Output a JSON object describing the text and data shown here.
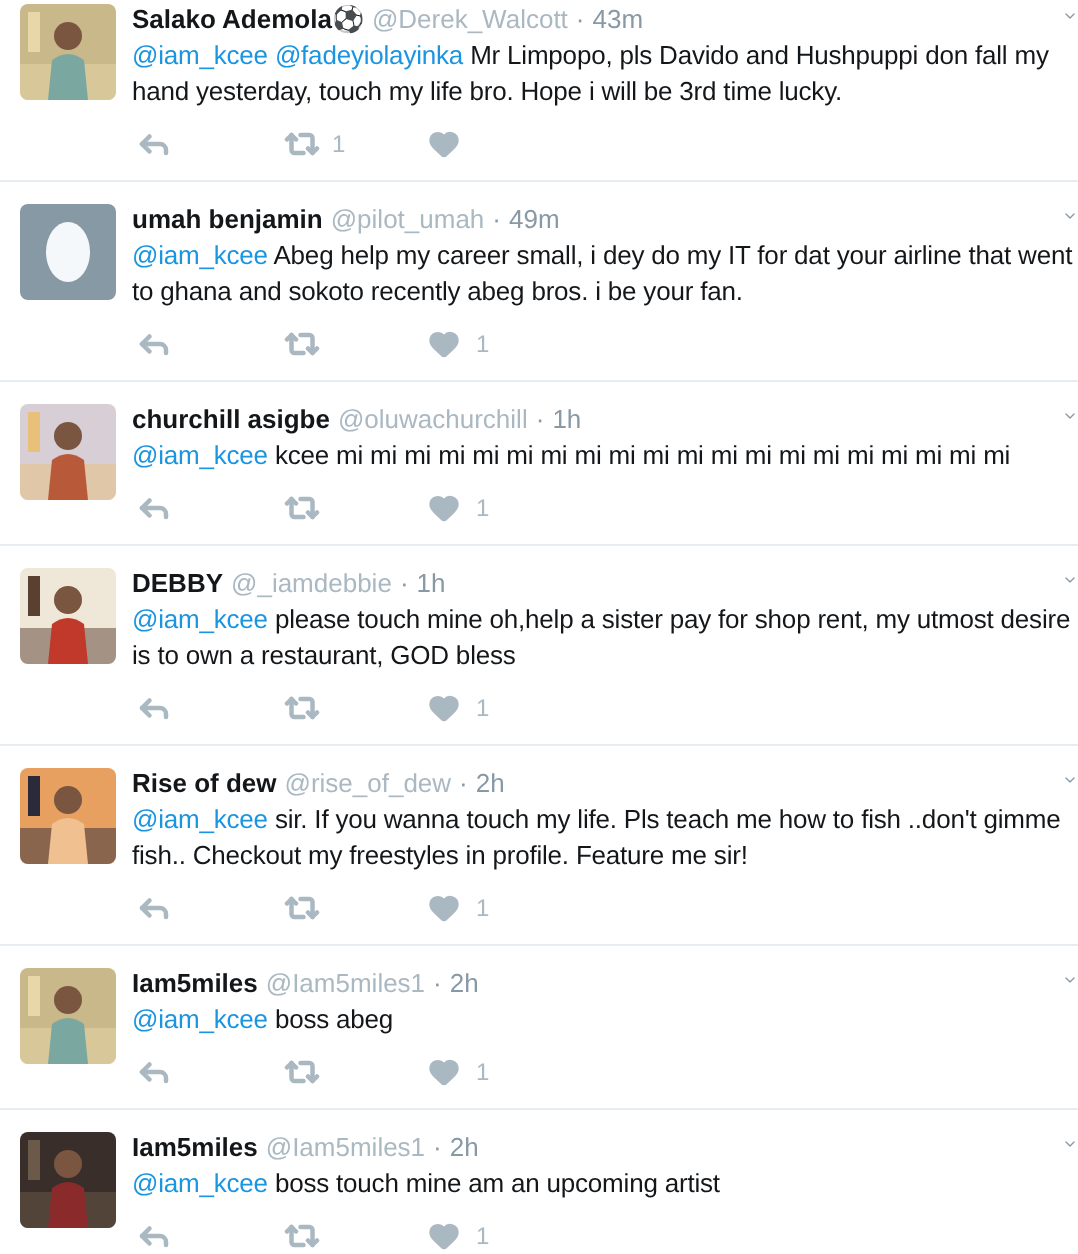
{
  "tweets": [
    {
      "name": "Salako Ademola⚽",
      "handle": "@Derek_Walcott",
      "separator": "·",
      "time": "43m",
      "avatar": {
        "kind": "picture"
      },
      "mentions": [
        "@iam_kcee",
        "@fadeyiolayinka"
      ],
      "text": "Mr Limpopo, pls Davido and Hushpuppi don fall my hand yesterday, touch my life bro. Hope i will be 3rd time lucky.",
      "retweets": "1"
    },
    {
      "name": "umah benjamin",
      "handle": "@pilot_umah",
      "separator": "·",
      "time": "49m",
      "avatar": {
        "kind": "egg"
      },
      "mentions": [
        "@iam_kcee"
      ],
      "text": "Abeg help my career small, i dey do my IT for dat your airline that went to ghana and sokoto recently abeg bros. i be your fan.",
      "likes": "1"
    },
    {
      "name": "churchill asigbe",
      "handle": "@oluwachurchill",
      "separator": "·",
      "time": "1h",
      "avatar": {
        "kind": "picture"
      },
      "mentions": [
        "@iam_kcee"
      ],
      "text": "kcee mi mi mi mi mi mi mi mi mi mi mi mi mi mi mi mi mi mi mi mi",
      "likes": "1"
    },
    {
      "name": "DEBBY",
      "handle": "@_iamdebbie",
      "separator": "·",
      "time": "1h",
      "avatar": {
        "kind": "picture"
      },
      "mentions": [
        "@iam_kcee"
      ],
      "text": "please touch mine oh,help a sister pay for shop rent, my utmost desire is to own a restaurant, GOD bless",
      "likes": "1"
    },
    {
      "name": "Rise of dew",
      "handle": "@rise_of_dew",
      "separator": "·",
      "time": "2h",
      "avatar": {
        "kind": "picture"
      },
      "mentions": [
        "@iam_kcee"
      ],
      "text": "sir. If you wanna touch my life. Pls teach me how to fish ..don't gimme fish.. Checkout my freestyles in profile. Feature me sir!",
      "likes": "1"
    },
    {
      "name": "Iam5miles",
      "handle": "@Iam5miles1",
      "separator": "·",
      "time": "2h",
      "avatar": {
        "kind": "picture"
      },
      "mentions": [
        "@iam_kcee"
      ],
      "text": "boss abeg",
      "likes": "1"
    },
    {
      "name": "Iam5miles",
      "handle": "@Iam5miles1",
      "separator": "·",
      "time": "2h",
      "avatar": {
        "kind": "picture"
      },
      "mentions": [
        "@iam_kcee"
      ],
      "text": "boss touch mine am an upcoming artist",
      "likes": "1"
    }
  ]
}
